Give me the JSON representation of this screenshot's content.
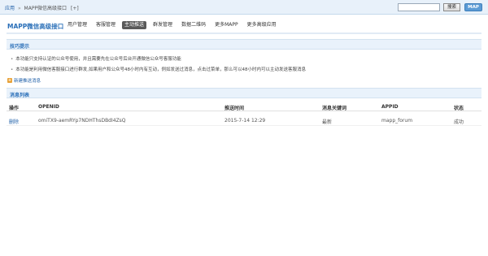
{
  "topbar": {
    "breadcrumb_home": "应用",
    "breadcrumb_sep": "»",
    "breadcrumb_current": "MAPP微信高级接口",
    "breadcrumb_plus": "[+]",
    "search_placeholder": "",
    "search_button": "搜索",
    "map_button": "MAP"
  },
  "header": {
    "app_title": "MAPP微信高级接口",
    "nav": [
      {
        "label": "用户管理"
      },
      {
        "label": "客服管理"
      },
      {
        "label": "主动推送",
        "active": true
      },
      {
        "label": "群发管理"
      },
      {
        "label": "数据二维码"
      },
      {
        "label": "更多MAPP"
      },
      {
        "label": "更多高级应用"
      }
    ]
  },
  "tips": {
    "title": "技巧提示",
    "items": [
      "本功能只支持认证的公众号使用，并且需要先在公众号后台开通微信公众号客服功能",
      "本功能是利用微信客服接口进行群发,如果用户和公众号48小时内有互动，例如发送过消息，点击过菜单，那么可以48小时内可以主动发送客服消息"
    ]
  },
  "actions": {
    "add_label": "新建推送消息"
  },
  "messages": {
    "title": "消息列表",
    "columns": [
      "操作",
      "OPENID",
      "推送时间",
      "消息关键词",
      "APPID",
      "状态"
    ],
    "rows": [
      {
        "action": "删除",
        "openid": "omiTX9-aemRYp7NDHThsDBdI4ZsQ",
        "time": "2015-7-14 12:29",
        "keyword": "最新",
        "appid": "mapp_forum",
        "status": "成功"
      }
    ]
  },
  "colors": {
    "accent": "#2a6fb8",
    "topbar_bg": "#e8f1fa",
    "section_bg": "#e9f2fb",
    "active_nav_bg": "#5a5a5a",
    "add_icon": "#e8a33a"
  }
}
